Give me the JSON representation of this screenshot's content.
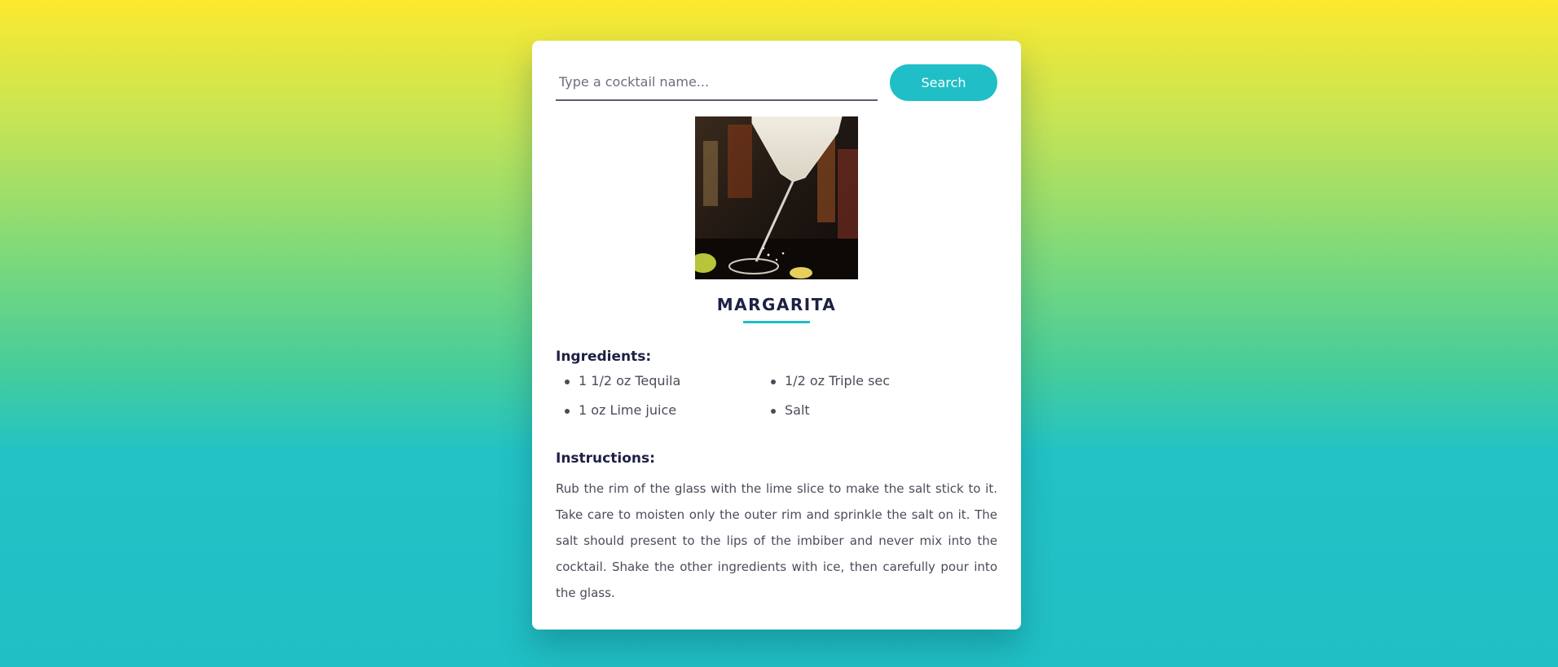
{
  "search": {
    "placeholder": "Type a cocktail name...",
    "value": "",
    "button_label": "Search"
  },
  "drink": {
    "name": "MARGARITA",
    "image_icon": "cocktail-glass-photo",
    "ingredients_heading": "Ingredients:",
    "ingredients": [
      "1 1/2 oz Tequila",
      "1/2 oz Triple sec",
      "1 oz Lime juice",
      "Salt"
    ],
    "instructions_heading": "Instructions:",
    "instructions": "Rub the rim of the glass with the lime slice to make the salt stick to it. Take care to moisten only the outer rim and sprinkle the salt on it. The salt should present to the lips of the imbiber and never mix into the cocktail. Shake the other ingredients with ice, then carefully pour into the glass."
  },
  "colors": {
    "accent": "#20bfc7",
    "heading": "#1e2044",
    "gradient_top": "#fde92f",
    "gradient_bottom": "#20bfc5"
  }
}
